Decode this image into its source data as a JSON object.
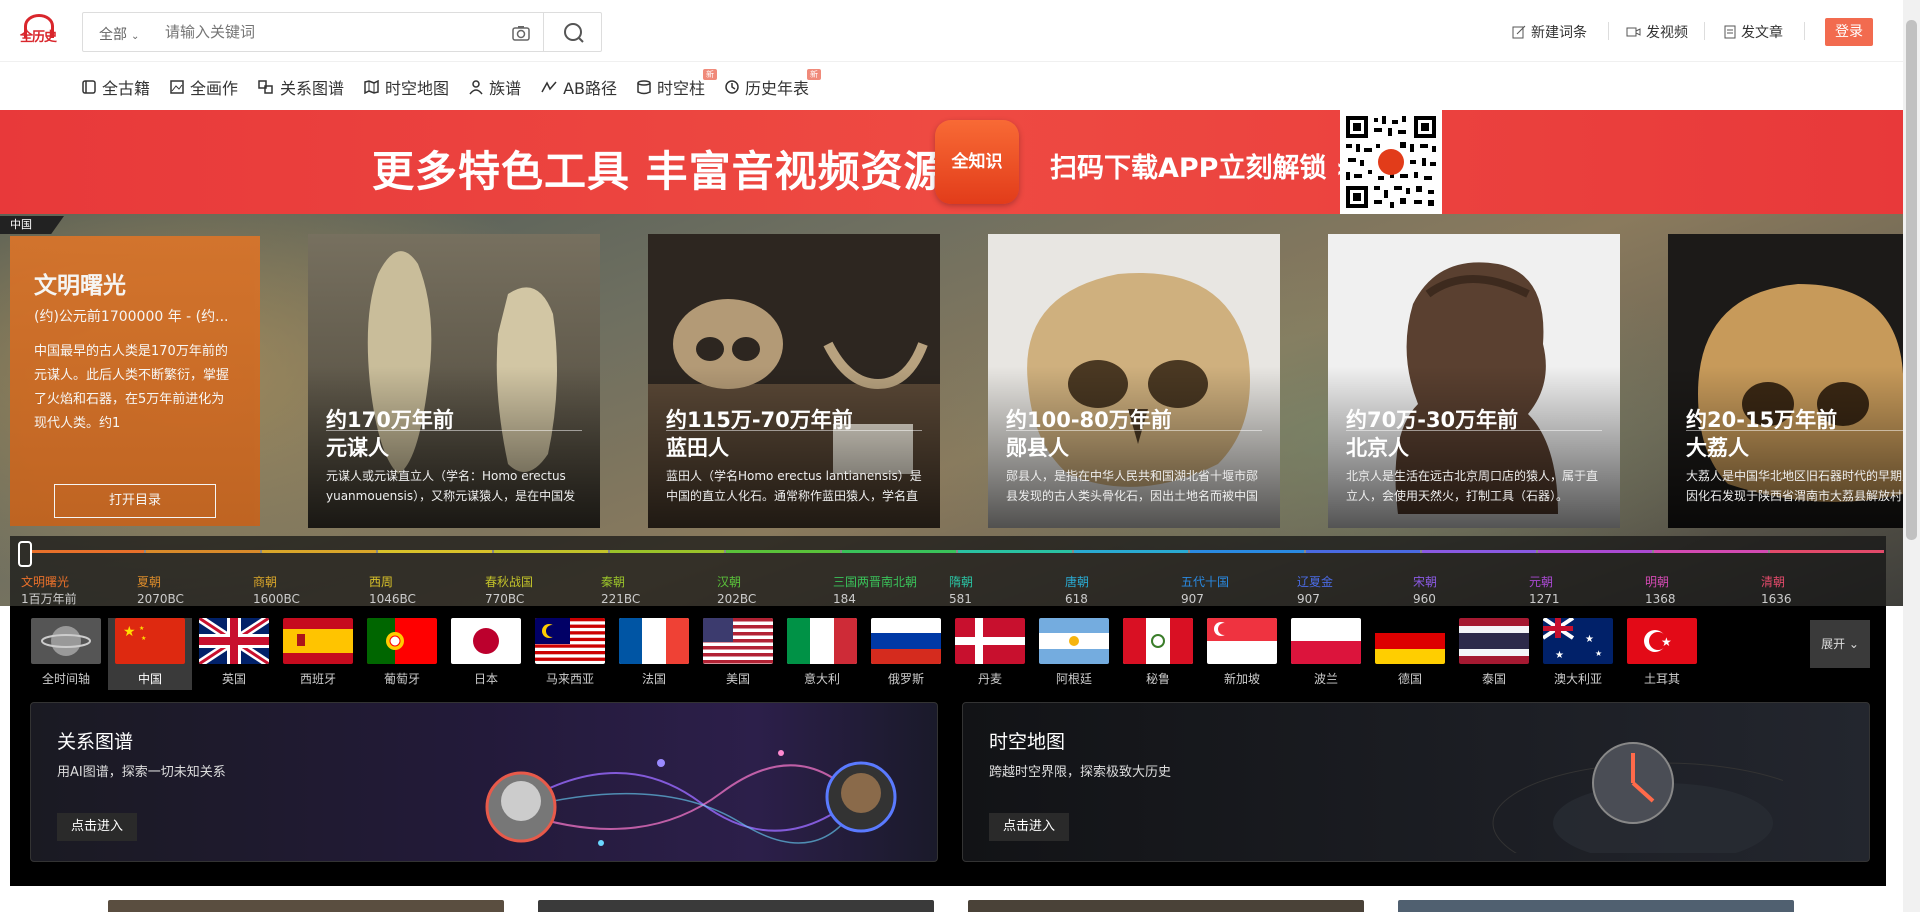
{
  "header": {
    "logo_text": "全历史",
    "search": {
      "category": "全部",
      "placeholder": "请输入关键词"
    },
    "actions": [
      {
        "label": "新建词条",
        "icon": "edit-icon"
      },
      {
        "label": "发视频",
        "icon": "video-icon"
      },
      {
        "label": "发文章",
        "icon": "article-icon"
      }
    ],
    "login_label": "登录"
  },
  "nav": [
    {
      "label": "全古籍",
      "icon": "book-icon",
      "new": ""
    },
    {
      "label": "全画作",
      "icon": "painting-icon",
      "new": ""
    },
    {
      "label": "关系图谱",
      "icon": "graph-icon",
      "new": ""
    },
    {
      "label": "时空地图",
      "icon": "map-icon",
      "new": ""
    },
    {
      "label": "族谱",
      "icon": "family-icon",
      "new": ""
    },
    {
      "label": "AB路径",
      "icon": "path-icon",
      "new": ""
    },
    {
      "label": "时空柱",
      "icon": "pillar-icon",
      "new": "新"
    },
    {
      "label": "历史年表",
      "icon": "clock-icon",
      "new": "新"
    }
  ],
  "banner": {
    "headline": "更多特色工具 丰富音视频资源",
    "app_logo": "全知识",
    "cta": "扫码下载APP立刻解锁 ›"
  },
  "hero": {
    "region": "中国",
    "intro": {
      "title": "文明曙光",
      "date": "(约)公元前1700000 年 - (约...",
      "text": "中国最早的古人类是170万年前的元谋人。此后人类不断繁衍，掌握了火焰和石器，在5万年前进化为现代人类。约1",
      "button": "打开目录"
    },
    "cards": [
      {
        "period": "约170万年前",
        "name": "元谋人",
        "desc": "元谋人或元谋直立人（学名：Homo erectus yuanmouensis），又称元谋猿人，是在中国发"
      },
      {
        "period": "约115万-70万年前",
        "name": "蓝田人",
        "desc": "蓝田人（学名Homo erectus lantianensis）是中国的直立人化石。通常称作蓝田猿人，学名直"
      },
      {
        "period": "约100-80万年前",
        "name": "郧县人",
        "desc": "郧县人，是指在中华人民共和国湖北省十堰市郧县发现的古人类头骨化石，因出土地名而被中国"
      },
      {
        "period": "约70万-30万年前",
        "name": "北京人",
        "desc": "北京人是生活在远古北京周口店的猿人，属于直立人，会使用天然火，打制工具（石器）。"
      },
      {
        "period": "约20-15万年前",
        "name": "大荔人",
        "desc": "大荔人是中国华北地区旧石器时代的早期人类，因化石发现于陕西省渭南市大荔县解放村"
      }
    ],
    "eras": [
      {
        "name": "文明曙光",
        "year": "1百万年前",
        "color": "#e8702a"
      },
      {
        "name": "夏朝",
        "year": "2070BC",
        "color": "#d98a2a"
      },
      {
        "name": "商朝",
        "year": "1600BC",
        "color": "#d9a62a"
      },
      {
        "name": "西周",
        "year": "1046BC",
        "color": "#d9c22a"
      },
      {
        "name": "春秋战国",
        "year": "770BC",
        "color": "#c2c22a"
      },
      {
        "name": "秦朝",
        "year": "221BC",
        "color": "#9ac22a"
      },
      {
        "name": "汉朝",
        "year": "202BC",
        "color": "#5ac23a"
      },
      {
        "name": "三国两晋南北朝",
        "year": "184",
        "color": "#3ac25a"
      },
      {
        "name": "隋朝",
        "year": "581",
        "color": "#2ac2a2"
      },
      {
        "name": "唐朝",
        "year": "618",
        "color": "#2aaad2"
      },
      {
        "name": "五代十国",
        "year": "907",
        "color": "#2a8ae2"
      },
      {
        "name": "辽夏金",
        "year": "907",
        "color": "#4a6ae2"
      },
      {
        "name": "宋朝",
        "year": "960",
        "color": "#8a5ae2"
      },
      {
        "name": "元朝",
        "year": "1271",
        "color": "#aa4ad2"
      },
      {
        "name": "明朝",
        "year": "1368",
        "color": "#d24ab2"
      },
      {
        "name": "清朝",
        "year": "1636",
        "color": "#e24a6a"
      }
    ]
  },
  "countries": {
    "items": [
      "全时间轴",
      "中国",
      "英国",
      "西班牙",
      "葡萄牙",
      "日本",
      "马来西亚",
      "法国",
      "美国",
      "意大利",
      "俄罗斯",
      "丹麦",
      "阿根廷",
      "秘鲁",
      "新加坡",
      "波兰",
      "德国",
      "泰国",
      "澳大利亚",
      "土耳其"
    ],
    "selected": "中国",
    "expand": "展开 ⌄"
  },
  "features": [
    {
      "title": "关系图谱",
      "sub": "用AI图谱，探索一切未知关系",
      "button": "点击进入"
    },
    {
      "title": "时空地图",
      "sub": "跨越时空界限，探索极致大历史",
      "button": "点击进入"
    }
  ]
}
